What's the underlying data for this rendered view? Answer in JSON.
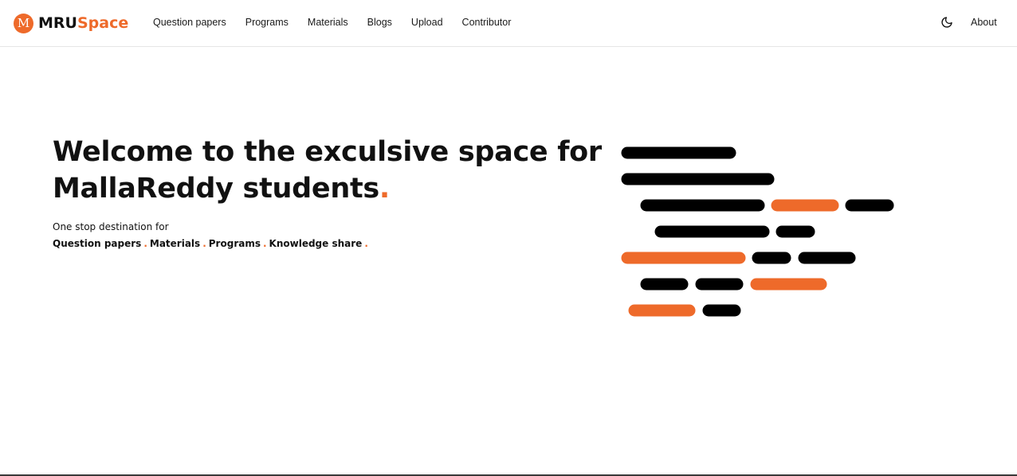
{
  "brand": {
    "badge_letter": "M",
    "name_part1": "MRU",
    "name_part2": "Space",
    "accent_color": "#ee6a2a"
  },
  "nav": {
    "items": [
      {
        "label": "Question papers"
      },
      {
        "label": "Programs"
      },
      {
        "label": "Materials"
      },
      {
        "label": "Blogs"
      },
      {
        "label": "Upload"
      },
      {
        "label": "Contributor"
      }
    ],
    "theme_icon": "moon-icon",
    "about_label": "About"
  },
  "hero": {
    "title_line1": "Welcome to the exculsive space for",
    "title_line2": "MallaReddy students",
    "title_dot": ".",
    "tagline": "One stop destination for",
    "features": [
      "Question papers",
      "Materials",
      "Programs",
      "Knowledge share"
    ],
    "feature_separator": "."
  },
  "illustration": {
    "type": "decorative-code-bars",
    "colors": {
      "dark": "#000000",
      "accent": "#ee6a2a"
    }
  }
}
